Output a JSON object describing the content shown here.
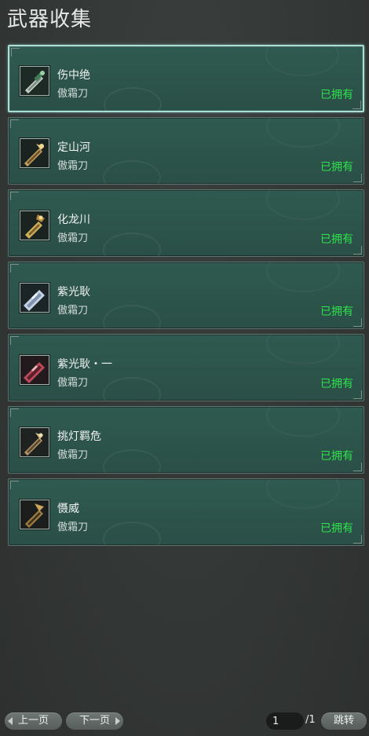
{
  "title": "武器收集",
  "weapons": [
    {
      "name": "伤中绝",
      "type": "傲霜刀",
      "status": "已拥有",
      "selected": true,
      "icon": "sword-icon-silver-green"
    },
    {
      "name": "定山河",
      "type": "傲霜刀",
      "status": "已拥有",
      "selected": false,
      "icon": "sword-icon-gold"
    },
    {
      "name": "化龙川",
      "type": "傲霜刀",
      "status": "已拥有",
      "selected": false,
      "icon": "sword-icon-gold-dragon"
    },
    {
      "name": "紫光耿",
      "type": "傲霜刀",
      "status": "已拥有",
      "selected": false,
      "icon": "sword-icon-silver-blue"
    },
    {
      "name": "紫光耿・一",
      "type": "傲霜刀",
      "status": "已拥有",
      "selected": false,
      "icon": "sword-icon-crimson"
    },
    {
      "name": "挑灯羁危",
      "type": "傲霜刀",
      "status": "已拥有",
      "selected": false,
      "icon": "sword-icon-bronze"
    },
    {
      "name": "慑威",
      "type": "傲霜刀",
      "status": "已拥有",
      "selected": false,
      "icon": "sword-icon-dark-gold"
    }
  ],
  "pagination": {
    "prev_label": "上一页",
    "next_label": "下一页",
    "current_page": "1",
    "total_label": "/1",
    "jump_label": "跳转"
  },
  "colors": {
    "owned_status": "#2ee24b",
    "card_bg": "#2c544b",
    "selected_border": "#a9dfd6"
  }
}
